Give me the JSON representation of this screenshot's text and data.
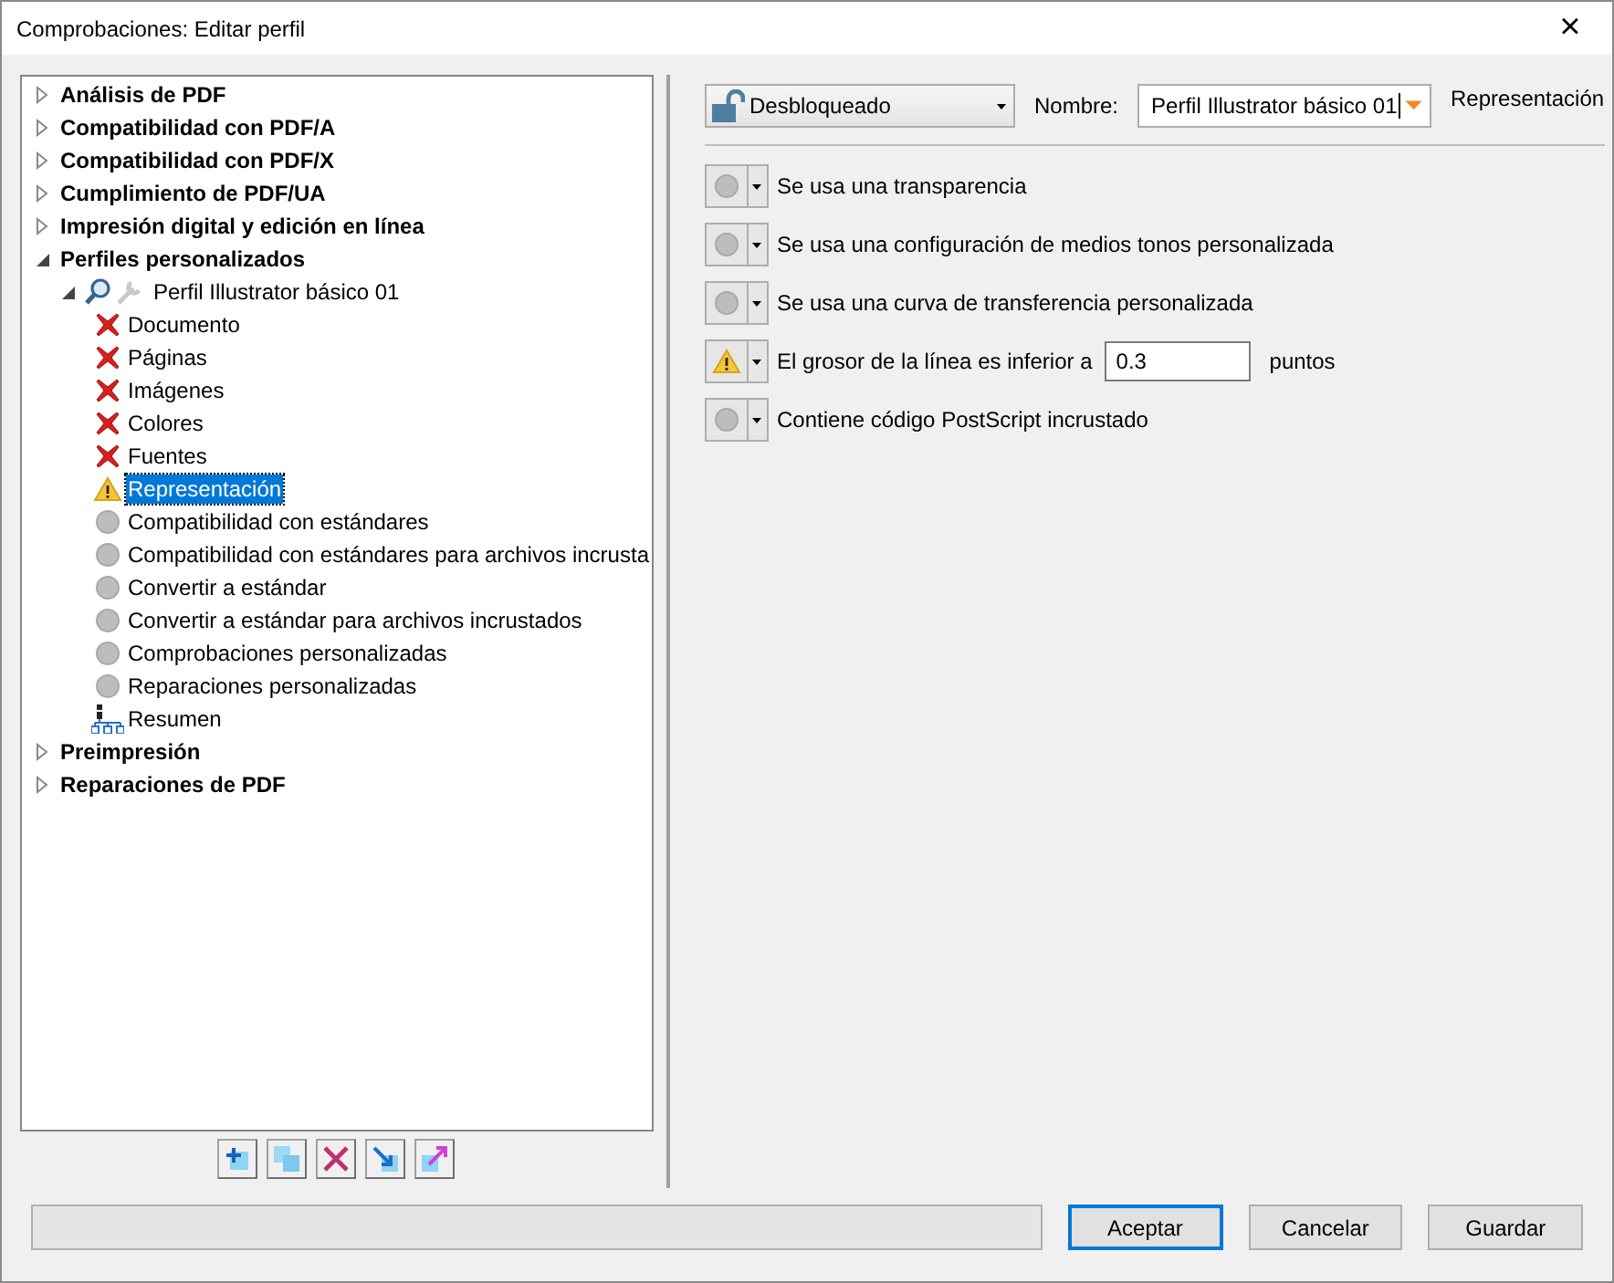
{
  "window": {
    "title": "Comprobaciones: Editar perfil",
    "close": "×"
  },
  "tree": [
    {
      "kind": "category",
      "label": "Análisis de PDF",
      "expanded": false,
      "selected": false
    },
    {
      "kind": "category",
      "label": "Compatibilidad con PDF/A",
      "expanded": false,
      "selected": false
    },
    {
      "kind": "category",
      "label": "Compatibilidad con PDF/X",
      "expanded": false,
      "selected": false
    },
    {
      "kind": "category",
      "label": "Cumplimiento de PDF/UA",
      "expanded": false,
      "selected": false
    },
    {
      "kind": "category",
      "label": "Impresión digital y edición en línea",
      "expanded": false,
      "selected": false
    },
    {
      "kind": "category",
      "label": "Perfiles personalizados",
      "expanded": true,
      "selected": false,
      "children": [
        {
          "kind": "profile",
          "label": "Perfil Illustrator básico 01",
          "expanded": true,
          "selected": false,
          "children": [
            {
              "kind": "error",
              "label": "Documento",
              "selected": false
            },
            {
              "kind": "error",
              "label": "Páginas",
              "selected": false
            },
            {
              "kind": "error",
              "label": "Imágenes",
              "selected": false
            },
            {
              "kind": "error",
              "label": "Colores",
              "selected": false
            },
            {
              "kind": "error",
              "label": "Fuentes",
              "selected": false
            },
            {
              "kind": "warning",
              "label": "Representación",
              "selected": true
            },
            {
              "kind": "off",
              "label": "Compatibilidad con estándares",
              "selected": false
            },
            {
              "kind": "off",
              "label": "Compatibilidad con estándares para archivos incrusta",
              "selected": false
            },
            {
              "kind": "off",
              "label": "Convertir a estándar",
              "selected": false
            },
            {
              "kind": "off",
              "label": "Convertir a estándar para archivos incrustados",
              "selected": false
            },
            {
              "kind": "off",
              "label": "Comprobaciones personalizadas",
              "selected": false
            },
            {
              "kind": "off",
              "label": "Reparaciones personalizadas",
              "selected": false
            },
            {
              "kind": "summary",
              "label": "Resumen",
              "selected": false
            }
          ]
        }
      ]
    },
    {
      "kind": "category",
      "label": "Preimpresión",
      "expanded": false,
      "selected": false
    },
    {
      "kind": "category",
      "label": "Reparaciones de PDF",
      "expanded": false,
      "selected": false
    }
  ],
  "tree_tools": [
    {
      "kind": "add"
    },
    {
      "kind": "duplicate"
    },
    {
      "kind": "delete"
    },
    {
      "kind": "import"
    },
    {
      "kind": "export"
    }
  ],
  "editor": {
    "lock": {
      "label": "Desbloqueado",
      "locked": false
    },
    "name_label": "Nombre:",
    "name_value": "Perfil Illustrator básico 01",
    "section": "Representación",
    "checks": [
      {
        "kind": "off",
        "label": "Se usa una transparencia"
      },
      {
        "kind": "off",
        "label": "Se usa una configuración de medios tonos personalizada"
      },
      {
        "kind": "off",
        "label": "Se usa una curva de transferencia personalizada"
      },
      {
        "kind": "warning",
        "label": "El grosor de la línea es inferior a",
        "value": "0.3",
        "unit": "puntos"
      },
      {
        "kind": "off",
        "label": "Contiene código PostScript incrustado"
      }
    ]
  },
  "buttons": [
    {
      "label": "Aceptar",
      "default": true
    },
    {
      "label": "Cancelar",
      "default": false
    },
    {
      "label": "Guardar",
      "default": false
    }
  ]
}
